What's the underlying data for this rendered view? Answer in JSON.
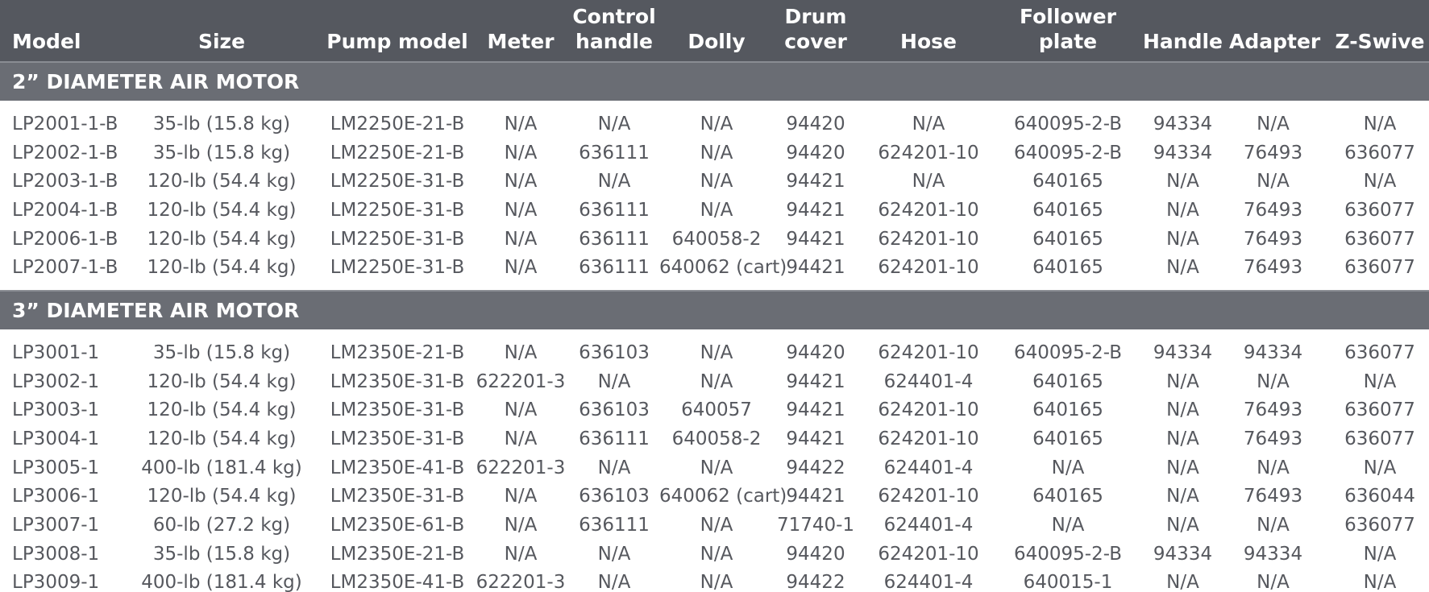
{
  "columns": [
    "Model",
    "Size",
    "Pump model",
    "Meter",
    "Control handle",
    "Dolly",
    "Drum cover",
    "Hose",
    "Follower plate",
    "Handle",
    "Adapter",
    "Z-Swive"
  ],
  "sections": [
    {
      "title": "2” DIAMETER AIR MOTOR",
      "rows": [
        [
          "LP2001-1-B",
          "35-lb (15.8 kg)",
          "LM2250E-21-B",
          "N/A",
          "N/A",
          "N/A",
          "94420",
          "N/A",
          "640095-2-B",
          "94334",
          "N/A",
          "N/A"
        ],
        [
          "LP2002-1-B",
          "35-lb (15.8 kg)",
          "LM2250E-21-B",
          "N/A",
          "636111",
          "N/A",
          "94420",
          "624201-10",
          "640095-2-B",
          "94334",
          "76493",
          "636077"
        ],
        [
          "LP2003-1-B",
          "120-lb (54.4 kg)",
          "LM2250E-31-B",
          "N/A",
          "N/A",
          "N/A",
          "94421",
          "N/A",
          "640165",
          "N/A",
          "N/A",
          "N/A"
        ],
        [
          "LP2004-1-B",
          "120-lb (54.4 kg)",
          "LM2250E-31-B",
          "N/A",
          "636111",
          "N/A",
          "94421",
          "624201-10",
          "640165",
          "N/A",
          "76493",
          "636077"
        ],
        [
          "LP2006-1-B",
          "120-lb (54.4 kg)",
          "LM2250E-31-B",
          "N/A",
          "636111",
          "640058-2",
          "94421",
          "624201-10",
          "640165",
          "N/A",
          "76493",
          "636077"
        ],
        [
          "LP2007-1-B",
          "120-lb (54.4 kg)",
          "LM2250E-31-B",
          "N/A",
          "636111",
          "640062 (cart)",
          "94421",
          "624201-10",
          "640165",
          "N/A",
          "76493",
          "636077"
        ]
      ]
    },
    {
      "title": "3” DIAMETER AIR MOTOR",
      "rows": [
        [
          "LP3001-1",
          "35-lb (15.8 kg)",
          "LM2350E-21-B",
          "N/A",
          "636103",
          "N/A",
          "94420",
          "624201-10",
          "640095-2-B",
          "94334",
          "94334",
          "636077"
        ],
        [
          "LP3002-1",
          "120-lb (54.4 kg)",
          "LM2350E-31-B",
          "622201-3",
          "N/A",
          "N/A",
          "94421",
          "624401-4",
          "640165",
          "N/A",
          "N/A",
          "N/A"
        ],
        [
          "LP3003-1",
          "120-lb (54.4 kg)",
          "LM2350E-31-B",
          "N/A",
          "636103",
          "640057",
          "94421",
          "624201-10",
          "640165",
          "N/A",
          "76493",
          "636077"
        ],
        [
          "LP3004-1",
          "120-lb (54.4 kg)",
          "LM2350E-31-B",
          "N/A",
          "636111",
          "640058-2",
          "94421",
          "624201-10",
          "640165",
          "N/A",
          "76493",
          "636077"
        ],
        [
          "LP3005-1",
          "400-lb (181.4 kg)",
          "LM2350E-41-B",
          "622201-3",
          "N/A",
          "N/A",
          "94422",
          "624401-4",
          "N/A",
          "N/A",
          "N/A",
          "N/A"
        ],
        [
          "LP3006-1",
          "120-lb (54.4 kg)",
          "LM2350E-31-B",
          "N/A",
          "636103",
          "640062 (cart)",
          "94421",
          "624201-10",
          "640165",
          "N/A",
          "76493",
          "636044"
        ],
        [
          "LP3007-1",
          "60-lb (27.2 kg)",
          "LM2350E-61-B",
          "N/A",
          "636111",
          "N/A",
          "71740-1",
          "624401-4",
          "N/A",
          "N/A",
          "N/A",
          "636077"
        ],
        [
          "LP3008-1",
          "35-lb (15.8 kg)",
          "LM2350E-21-B",
          "N/A",
          "N/A",
          "N/A",
          "94420",
          "624201-10",
          "640095-2-B",
          "94334",
          "94334",
          "N/A"
        ],
        [
          "LP3009-1",
          "400-lb (181.4 kg)",
          "LM2350E-41-B",
          "622201-3",
          "N/A",
          "N/A",
          "94422",
          "624401-4",
          "640015-1",
          "N/A",
          "N/A",
          "N/A"
        ]
      ]
    }
  ],
  "colors": {
    "header_bg": "#55585f",
    "section_bg": "#6a6d74",
    "header_text": "#ffffff",
    "body_text": "#56585e"
  }
}
